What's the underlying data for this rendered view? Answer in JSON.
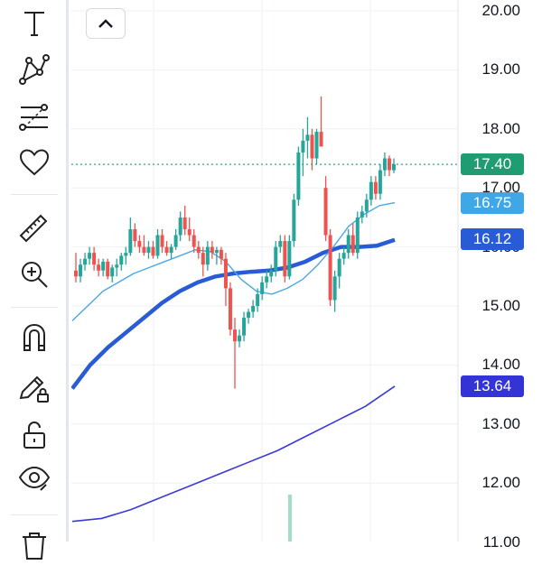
{
  "toolbar": {
    "tools": [
      "text-tool",
      "trend-line-tool",
      "fib-retracement-tool",
      "favorites-tool",
      "ruler-tool",
      "zoom-in-tool",
      "magnet-tool",
      "lock-drawing-tool",
      "unlock-tool",
      "hide-drawings-tool",
      "delete-tool"
    ]
  },
  "collapse_button_icon": "chevron-up-icon",
  "colors": {
    "up": "#26a69a",
    "down": "#ef5350",
    "ma_thin": "#4aa8e8",
    "ma_thick": "#2a5bd7",
    "ma_long": "#3a3ad8",
    "last_price": "#1f9c72",
    "grid": "#eef0f4"
  },
  "price_axis": {
    "labels": [
      "20.00",
      "19.00",
      "18.00",
      "17.00",
      "16.00",
      "15.00",
      "14.00",
      "13.00",
      "12.00",
      "11.00"
    ],
    "min": 11.0,
    "max": 20.0
  },
  "badges": {
    "last_price": "17.40",
    "ma_short": "16.75",
    "ma_medium": "16.12",
    "ma_long": "13.64"
  },
  "chart_data": {
    "type": "candlestick",
    "candles": [
      [
        15.6,
        15.9,
        15.4,
        15.5
      ],
      [
        15.5,
        15.8,
        15.4,
        15.7
      ],
      [
        15.7,
        15.9,
        15.6,
        15.8
      ],
      [
        15.8,
        16.0,
        15.7,
        15.9
      ],
      [
        15.9,
        16.0,
        15.6,
        15.7
      ],
      [
        15.7,
        15.8,
        15.5,
        15.6
      ],
      [
        15.6,
        15.8,
        15.5,
        15.75
      ],
      [
        15.75,
        15.8,
        15.45,
        15.5
      ],
      [
        15.5,
        15.7,
        15.4,
        15.65
      ],
      [
        15.65,
        15.8,
        15.5,
        15.7
      ],
      [
        15.7,
        15.9,
        15.6,
        15.85
      ],
      [
        15.85,
        16.0,
        15.7,
        15.9
      ],
      [
        15.9,
        16.5,
        15.85,
        16.3
      ],
      [
        16.3,
        16.4,
        16.0,
        16.1
      ],
      [
        16.1,
        16.2,
        15.9,
        16.0
      ],
      [
        16.0,
        16.2,
        15.85,
        15.9
      ],
      [
        15.9,
        16.1,
        15.8,
        16.0
      ],
      [
        16.0,
        16.1,
        15.8,
        15.85
      ],
      [
        15.85,
        16.3,
        15.8,
        16.2
      ],
      [
        16.2,
        16.3,
        15.9,
        16.0
      ],
      [
        16.0,
        16.1,
        15.85,
        15.9
      ],
      [
        15.9,
        16.05,
        15.8,
        16.0
      ],
      [
        16.0,
        16.3,
        15.95,
        16.2
      ],
      [
        16.2,
        16.6,
        16.1,
        16.5
      ],
      [
        16.5,
        16.7,
        16.2,
        16.3
      ],
      [
        16.3,
        16.5,
        16.1,
        16.2
      ],
      [
        16.2,
        16.3,
        15.9,
        16.0
      ],
      [
        16.0,
        16.1,
        15.8,
        15.9
      ],
      [
        15.9,
        16.0,
        15.5,
        15.7
      ],
      [
        15.7,
        16.1,
        15.6,
        16.0
      ],
      [
        16.0,
        16.1,
        15.8,
        15.9
      ],
      [
        15.9,
        16.0,
        15.7,
        15.95
      ],
      [
        15.95,
        16.0,
        15.7,
        15.8
      ],
      [
        15.8,
        15.9,
        15.0,
        15.3
      ],
      [
        15.3,
        15.4,
        14.5,
        14.6
      ],
      [
        14.6,
        14.8,
        13.6,
        14.4
      ],
      [
        14.4,
        14.6,
        14.3,
        14.5
      ],
      [
        14.5,
        14.9,
        14.4,
        14.8
      ],
      [
        14.8,
        14.95,
        14.7,
        14.9
      ],
      [
        14.9,
        15.1,
        14.8,
        15.0
      ],
      [
        15.0,
        15.3,
        14.9,
        15.2
      ],
      [
        15.2,
        15.5,
        15.1,
        15.4
      ],
      [
        15.4,
        15.6,
        15.3,
        15.5
      ],
      [
        15.5,
        15.7,
        15.4,
        15.6
      ],
      [
        15.6,
        16.1,
        15.5,
        16.0
      ],
      [
        16.0,
        16.2,
        15.9,
        16.1
      ],
      [
        16.1,
        16.2,
        15.4,
        15.5
      ],
      [
        15.5,
        16.2,
        15.45,
        16.1
      ],
      [
        16.1,
        16.9,
        16.0,
        16.8
      ],
      [
        16.8,
        17.7,
        16.7,
        17.6
      ],
      [
        17.6,
        18.0,
        17.2,
        17.8
      ],
      [
        17.8,
        18.2,
        17.5,
        17.9
      ],
      [
        17.9,
        18.0,
        17.3,
        17.5
      ],
      [
        17.5,
        18.0,
        17.4,
        17.95
      ],
      [
        17.95,
        18.55,
        17.8,
        17.7
      ],
      [
        17.0,
        17.2,
        16.1,
        16.2
      ],
      [
        16.2,
        16.3,
        15.0,
        15.1
      ],
      [
        15.1,
        15.6,
        14.9,
        15.5
      ],
      [
        15.5,
        15.9,
        15.3,
        15.8
      ],
      [
        15.8,
        16.0,
        15.7,
        15.9
      ],
      [
        15.9,
        16.3,
        15.8,
        16.2
      ],
      [
        16.2,
        16.4,
        15.85,
        15.9
      ],
      [
        15.9,
        16.6,
        15.8,
        16.5
      ],
      [
        16.5,
        16.7,
        16.4,
        16.6
      ],
      [
        16.6,
        16.9,
        16.5,
        16.8
      ],
      [
        16.8,
        17.2,
        16.7,
        17.1
      ],
      [
        17.1,
        17.2,
        16.8,
        16.9
      ],
      [
        16.9,
        17.4,
        16.8,
        17.3
      ],
      [
        17.3,
        17.6,
        17.2,
        17.5
      ],
      [
        17.5,
        17.55,
        17.2,
        17.3
      ],
      [
        17.3,
        17.5,
        17.25,
        17.4
      ]
    ],
    "moving_averages": [
      {
        "values": [
          14.75,
          15.0,
          15.25,
          15.4,
          15.55,
          15.65,
          15.75,
          15.85,
          15.95,
          15.92,
          15.75,
          15.45,
          15.25,
          15.2,
          15.3,
          15.45,
          15.7,
          16.0,
          16.35,
          16.55,
          16.7,
          16.75
        ]
      },
      {
        "values": [
          13.6,
          14.0,
          14.3,
          14.55,
          14.8,
          15.05,
          15.25,
          15.4,
          15.5,
          15.55,
          15.58,
          15.6,
          15.65,
          15.75,
          15.9,
          16.0,
          16.0,
          16.02,
          16.12
        ]
      },
      {
        "values": [
          11.35,
          11.4,
          11.55,
          11.75,
          11.95,
          12.15,
          12.35,
          12.55,
          12.8,
          13.05,
          13.3,
          13.64
        ]
      }
    ],
    "last_price": 17.4,
    "volume_tick_value": 1.0
  }
}
